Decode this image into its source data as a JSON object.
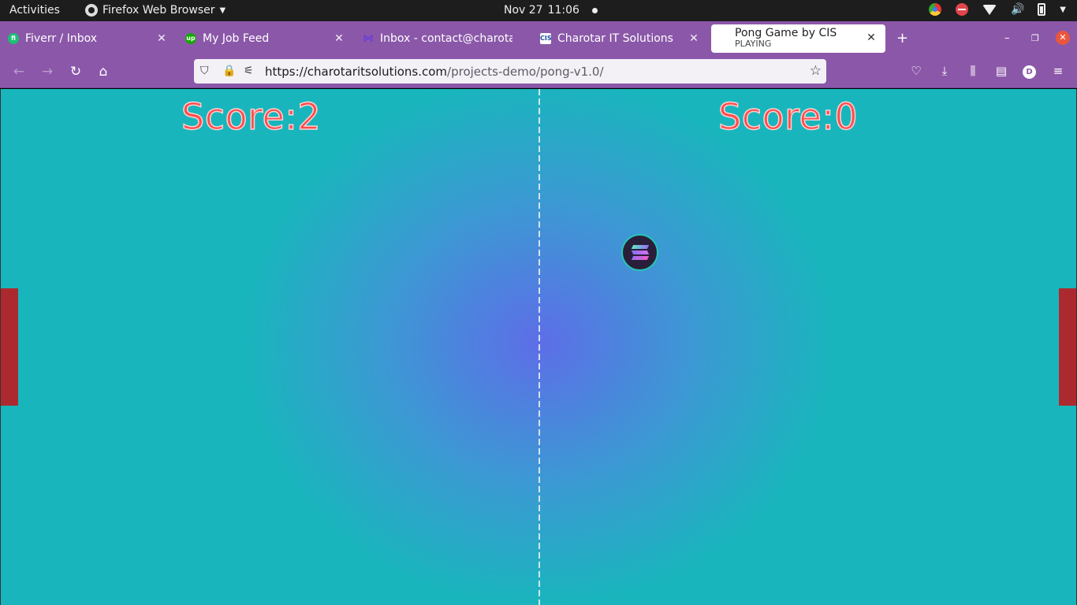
{
  "system_bar": {
    "activities": "Activities",
    "app_name": "Firefox Web Browser",
    "date": "Nov 27",
    "time": "11:06"
  },
  "tabs": [
    {
      "title": "Fiverr / Inbox",
      "favicon": "fiverr-icon",
      "favicon_color": "#1dbf73"
    },
    {
      "title": "My Job Feed",
      "favicon": "upwork-icon",
      "favicon_color": "#14a800"
    },
    {
      "title": "Inbox - contact@charotar",
      "favicon": "mail-icon",
      "favicon_color": "#6b3fd4"
    },
    {
      "title": "Charotar IT Solutions",
      "favicon": "cis-icon",
      "favicon_color": "#1f4fa0"
    },
    {
      "title": "Pong Game by CIS",
      "subtitle": "PLAYING",
      "active": true
    }
  ],
  "navigation": {
    "url_host": "https://charotaritsolutions.com",
    "url_path": "/projects-demo/pong-v1.0/",
    "account_initial": "D"
  },
  "game": {
    "left_score_text": "Score:2",
    "right_score_text": "Score:0",
    "left_score": 2,
    "right_score": 0,
    "colors": {
      "background_center": "#5d6ee8",
      "background_edge": "#18b6bc",
      "paddle": "#ac2a2f",
      "score": "#ff4b4b"
    }
  },
  "colors": {
    "browser_chrome": "#8b58a9",
    "close_button": "#e9563d"
  }
}
